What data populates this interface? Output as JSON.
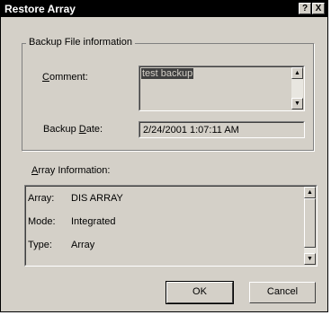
{
  "window": {
    "title": "Restore Array",
    "help_glyph": "?",
    "close_glyph": "X"
  },
  "backup_group": {
    "legend": "Backup File information",
    "comment_label": "Comment:",
    "comment_value": "test backup",
    "date_label": "Backup Date:",
    "date_value": "2/24/2001 1:07:11 AM"
  },
  "array_info": {
    "label": "Array Information:",
    "rows": [
      {
        "key": "Array:",
        "value": "DIS ARRAY"
      },
      {
        "key": "Mode:",
        "value": "Integrated"
      },
      {
        "key": "Type:",
        "value": "Array"
      }
    ]
  },
  "buttons": {
    "ok": "OK",
    "cancel": "Cancel"
  },
  "icons": {
    "scroll_up": "scroll-up-arrow-icon",
    "scroll_down": "scroll-down-arrow-icon"
  }
}
